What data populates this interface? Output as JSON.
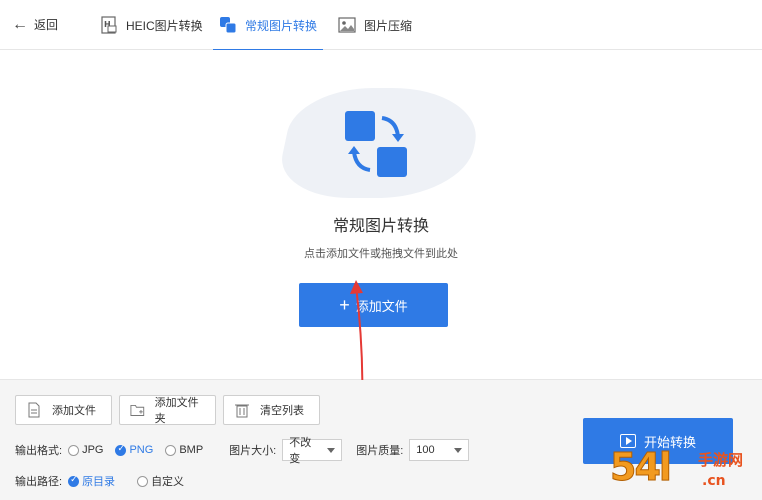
{
  "topbar": {
    "back_label": "返回",
    "tabs": [
      {
        "label": "HEIC图片转换",
        "icon": "heic-file-icon"
      },
      {
        "label": "常规图片转换",
        "icon": "convert-icon",
        "active": true
      },
      {
        "label": "图片压缩",
        "icon": "image-compress-icon"
      }
    ]
  },
  "main": {
    "title": "常规图片转换",
    "subtitle": "点击添加文件或拖拽文件到此处",
    "add_button": "添加文件"
  },
  "toolbar": {
    "add_file": "添加文件",
    "add_folder": "添加文件夹",
    "clear_list": "清空列表"
  },
  "options": {
    "format_label": "输出格式:",
    "formats": [
      "JPG",
      "PNG",
      "BMP"
    ],
    "selected_format": "PNG",
    "size_label": "图片大小:",
    "size_value": "不改变",
    "quality_label": "图片质量:",
    "quality_value": "100",
    "path_label": "输出路径:",
    "paths": [
      "原目录",
      "自定义"
    ],
    "selected_path": "原目录"
  },
  "start_button": "开始转换",
  "colors": {
    "accent": "#2f7ae5",
    "pointer": "#e53935",
    "watermark": "#f29a1f"
  },
  "watermark": {
    "number": "54l",
    "cn": "手游网",
    "domain": ".cn"
  }
}
